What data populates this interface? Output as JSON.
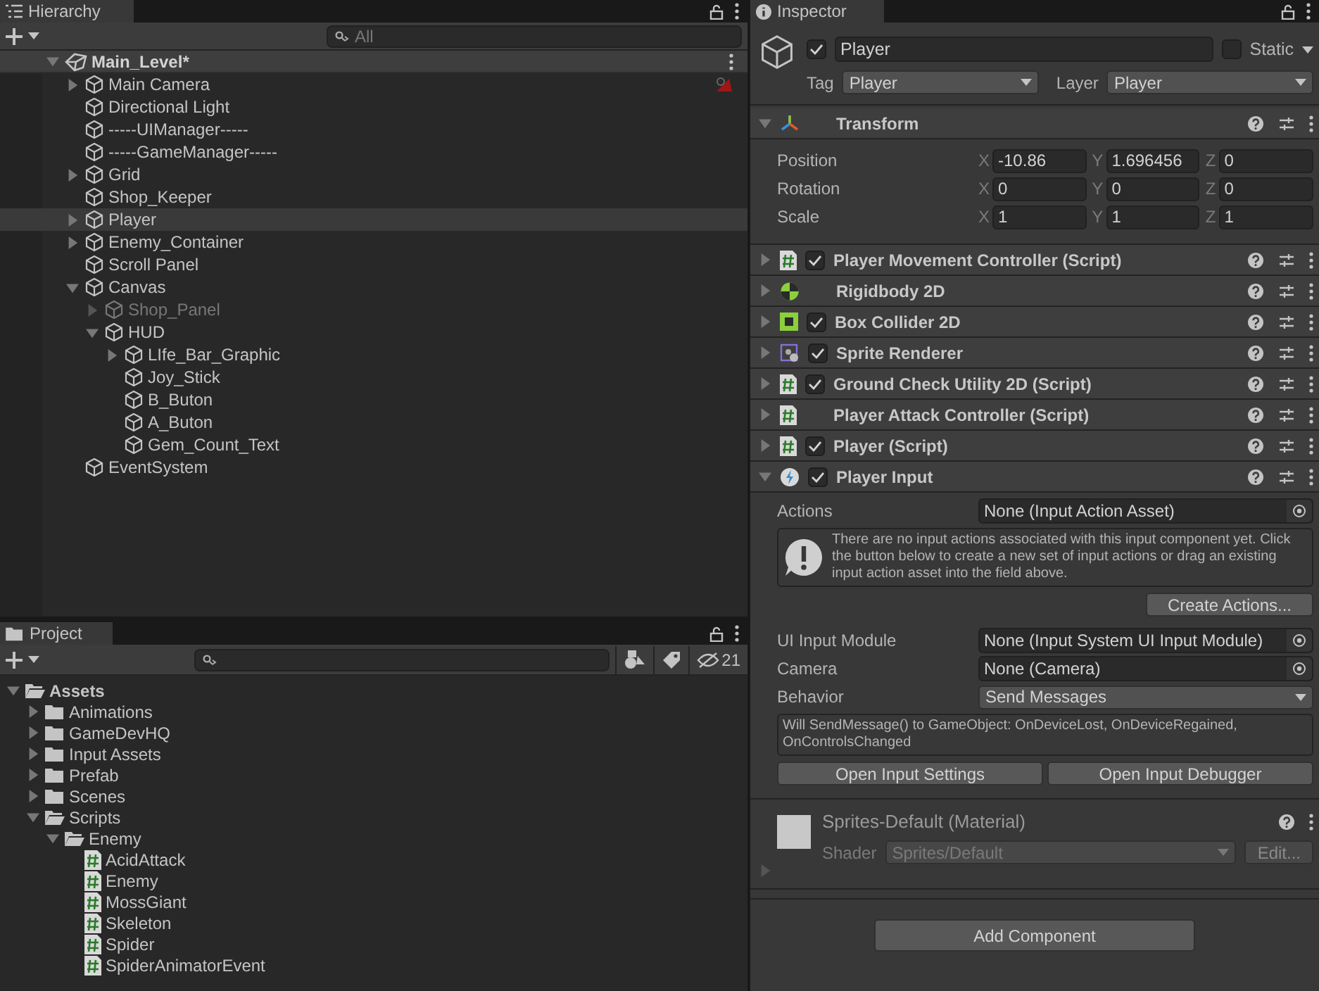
{
  "hierarchy": {
    "tab": "Hierarchy",
    "search_placeholder": "All",
    "scene": {
      "name": "Main_Level*",
      "expanded": true,
      "items": [
        {
          "name": "Main Camera",
          "expanded": false,
          "gizmo_icon": true,
          "selected": false,
          "inactive": false
        },
        {
          "name": "Directional Light",
          "selected": false,
          "inactive": false
        },
        {
          "name": "-----UIManager-----",
          "selected": false,
          "inactive": false
        },
        {
          "name": "-----GameManager-----",
          "selected": false,
          "inactive": false
        },
        {
          "name": "Grid",
          "expanded": false,
          "selected": false,
          "inactive": false
        },
        {
          "name": "Shop_Keeper",
          "selected": false,
          "inactive": false
        },
        {
          "name": "Player",
          "expanded": false,
          "selected": true,
          "inactive": false
        },
        {
          "name": "Enemy_Container",
          "expanded": false,
          "selected": false,
          "inactive": false
        },
        {
          "name": "Scroll Panel",
          "selected": false,
          "inactive": false
        },
        {
          "name": "Canvas",
          "expanded": true,
          "selected": false,
          "inactive": false,
          "children": [
            {
              "name": "Shop_Panel",
              "expanded": false,
              "selected": false,
              "inactive": true
            },
            {
              "name": "HUD",
              "expanded": true,
              "selected": false,
              "inactive": false,
              "children": [
                {
                  "name": "LIfe_Bar_Graphic",
                  "expanded": false,
                  "selected": false,
                  "inactive": false
                },
                {
                  "name": "Joy_Stick",
                  "selected": false,
                  "inactive": false
                },
                {
                  "name": "B_Buton",
                  "selected": false,
                  "inactive": false
                },
                {
                  "name": "A_Buton",
                  "selected": false,
                  "inactive": false
                },
                {
                  "name": "Gem_Count_Text",
                  "selected": false,
                  "inactive": false
                }
              ]
            }
          ]
        },
        {
          "name": "EventSystem",
          "selected": false,
          "inactive": false
        }
      ]
    }
  },
  "project": {
    "tab": "Project",
    "hidden_count": "21",
    "tree": [
      {
        "kind": "folder",
        "name": "Assets",
        "expanded": true,
        "children": [
          {
            "kind": "folder",
            "name": "Animations",
            "expanded": false
          },
          {
            "kind": "folder",
            "name": "GameDevHQ",
            "expanded": false
          },
          {
            "kind": "folder",
            "name": "Input Assets",
            "expanded": false
          },
          {
            "kind": "folder",
            "name": "Prefab",
            "expanded": false
          },
          {
            "kind": "folder",
            "name": "Scenes",
            "expanded": false
          },
          {
            "kind": "folder",
            "name": "Scripts",
            "expanded": true,
            "children": [
              {
                "kind": "folder",
                "name": "Enemy",
                "expanded": true,
                "children": [
                  {
                    "kind": "script",
                    "name": "AcidAttack"
                  },
                  {
                    "kind": "script",
                    "name": "Enemy"
                  },
                  {
                    "kind": "script",
                    "name": "MossGiant"
                  },
                  {
                    "kind": "script",
                    "name": "Skeleton"
                  },
                  {
                    "kind": "script",
                    "name": "Spider"
                  },
                  {
                    "kind": "script",
                    "name": "SpiderAnimatorEvent"
                  }
                ]
              }
            ]
          }
        ]
      }
    ]
  },
  "inspector": {
    "tab": "Inspector",
    "object": {
      "active": true,
      "name": "Player",
      "static": false,
      "static_label": "Static",
      "tag_label": "Tag",
      "tag": "Player",
      "layer_label": "Layer",
      "layer": "Player"
    },
    "components": [
      {
        "kind": "transform",
        "name": "Transform",
        "expanded": true,
        "rows": [
          {
            "label": "Position",
            "axes": [
              "X",
              "Y",
              "Z"
            ],
            "values": [
              "-10.86",
              "1.696456",
              "0"
            ]
          },
          {
            "label": "Rotation",
            "axes": [
              "X",
              "Y",
              "Z"
            ],
            "values": [
              "0",
              "0",
              "0"
            ]
          },
          {
            "label": "Scale",
            "axes": [
              "X",
              "Y",
              "Z"
            ],
            "values": [
              "1",
              "1",
              "1"
            ]
          }
        ]
      },
      {
        "kind": "script",
        "name": "Player Movement Controller (Script)",
        "expanded": false,
        "enabled": true
      },
      {
        "kind": "rigidbody",
        "name": "Rigidbody 2D",
        "expanded": false
      },
      {
        "kind": "box_collider",
        "name": "Box Collider 2D",
        "expanded": false,
        "enabled": true
      },
      {
        "kind": "sprite_renderer",
        "name": "Sprite Renderer",
        "expanded": false,
        "enabled": true
      },
      {
        "kind": "script",
        "name": "Ground Check Utility 2D (Script)",
        "expanded": false,
        "enabled": true
      },
      {
        "kind": "script",
        "name": "Player Attack Controller (Script)",
        "expanded": false
      },
      {
        "kind": "script",
        "name": "Player (Script)",
        "expanded": false,
        "enabled": true
      },
      {
        "kind": "player_input",
        "name": "Player Input",
        "expanded": true,
        "enabled": true,
        "actions": {
          "label": "Actions",
          "value": "None (Input Action Asset)"
        },
        "help": "There are no input actions associated with this input component yet. Click the button below to create a new set of input actions or drag an existing input action asset into the field above.",
        "create_button": "Create Actions...",
        "fields": [
          {
            "kind": "object",
            "label": "UI Input Module",
            "value": "None (Input System UI Input Module)"
          },
          {
            "kind": "object",
            "label": "Camera",
            "value": "None (Camera)"
          },
          {
            "kind": "dropdown",
            "label": "Behavior",
            "value": "Send Messages"
          }
        ],
        "info": "Will SendMessage() to GameObject: OnDeviceLost, OnDeviceRegained, OnControlsChanged",
        "buttons": [
          "Open Input Settings",
          "Open Input Debugger"
        ]
      }
    ],
    "material": {
      "name": "Sprites-Default (Material)",
      "shader_label": "Shader",
      "shader": "Sprites/Default",
      "edit_button": "Edit...",
      "expanded": false
    },
    "add_component": "Add Component"
  }
}
